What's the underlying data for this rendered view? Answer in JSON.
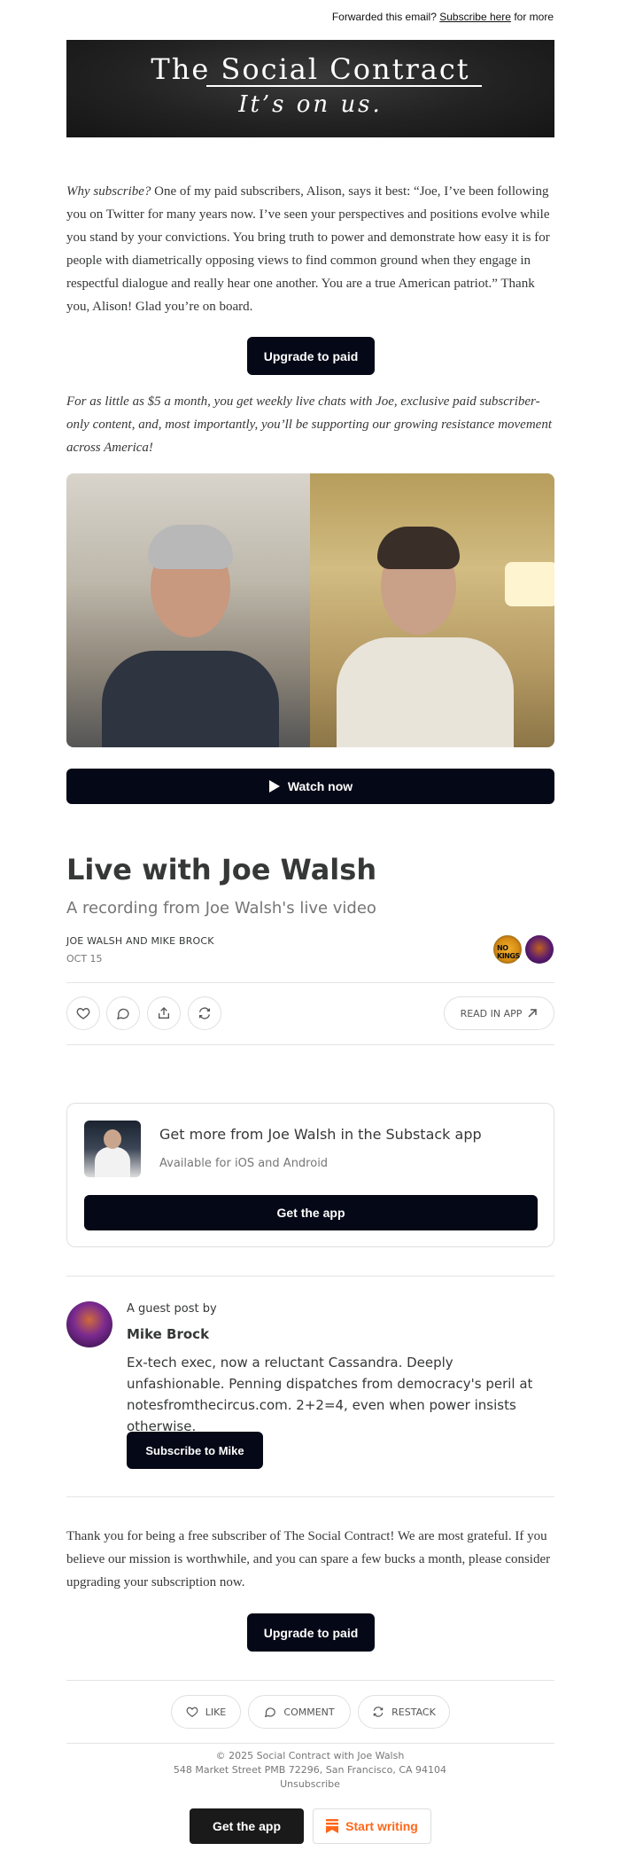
{
  "top": {
    "forwarded_text": "Forwarded this email?",
    "subscribe_link": "Subscribe here",
    "for_more": "for more"
  },
  "banner": {
    "title": "The Social Contract",
    "tagline": "It’s on us."
  },
  "intro": {
    "lead": "Why subscribe?",
    "body": " One of my paid subscribers, Alison, says it best: “Joe, I’ve been following you on Twitter for many years now. I’ve seen your perspectives and positions evolve while you stand by your convictions. You bring truth to power and demonstrate how easy it is for people with diametrically opposing views to find common ground when they engage in respectful dialogue and really hear one another. You are a true American patriot.” Thank you, Alison! Glad you’re on board."
  },
  "upgrade_label": "Upgrade to paid",
  "pitch": "For as little as $5 a month, you get weekly live chats with Joe, exclusive paid subscriber-only content, and, most importantly, you’ll be supporting our growing resistance movement across America!",
  "video": {
    "watch_label": "Watch now"
  },
  "post": {
    "title": "Live with Joe Walsh",
    "subtitle": "A recording from Joe Walsh's live video",
    "authors": "JOE WALSH AND MIKE BROCK",
    "date": "OCT 15",
    "avatar1_text": "NO KINGS"
  },
  "actions": {
    "read_in_app": "READ IN APP"
  },
  "app_card": {
    "title": "Get more from Joe Walsh in the Substack app",
    "subtitle": "Available for iOS and Android",
    "button": "Get the app"
  },
  "guest": {
    "label": "A guest post by",
    "name": "Mike Brock",
    "bio": "Ex-tech exec, now a reluctant Cassandra. Deeply unfashionable. Penning dispatches from democracy's peril at notesfromthecircus.com. 2+2=4, even when power insists otherwise.",
    "button": "Subscribe to Mike"
  },
  "closing": "Thank you for being a free subscriber of The Social Contract! We are most grateful. If you believe our mission is worthwhile, and you can spare a few bucks a month, please consider upgrading your subscription now.",
  "footer_actions": {
    "like": "LIKE",
    "comment": "COMMENT",
    "restack": "RESTACK"
  },
  "footer": {
    "copyright": "© 2025 Social Contract with Joe Walsh",
    "address": "548 Market Street PMB 72296, San Francisco, CA 94104",
    "unsubscribe": "Unsubscribe",
    "get_app": "Get the app",
    "start_writing": "Start writing"
  },
  "colors": {
    "dark_button": "#050816",
    "accent_orange": "#ff6719",
    "text": "#363737",
    "muted": "#757575"
  }
}
